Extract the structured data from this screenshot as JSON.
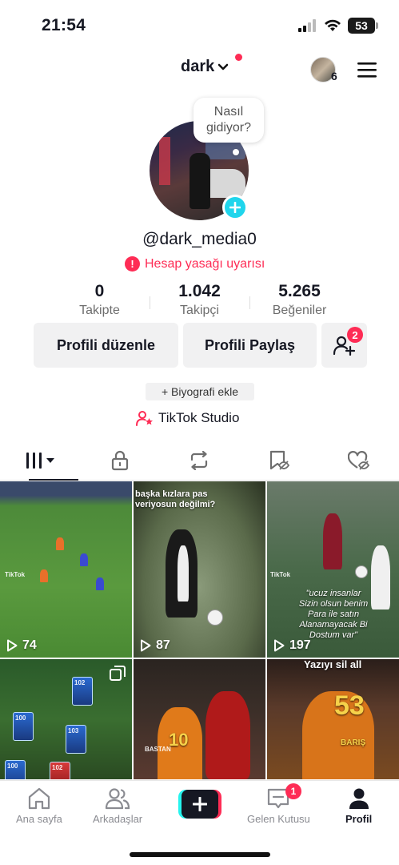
{
  "status_bar": {
    "time": "21:54",
    "battery": "53"
  },
  "header": {
    "account_name": "dark",
    "story_count": "6"
  },
  "profile": {
    "note": "Nasıl gidiyor?",
    "username": "@dark_media0",
    "ban_warning": "Hesap yasağı uyarısı",
    "stats": [
      {
        "value": "0",
        "label": "Takipte"
      },
      {
        "value": "1.042",
        "label": "Takipçi"
      },
      {
        "value": "5.265",
        "label": "Beğeniler"
      }
    ],
    "edit_button": "Profili düzenle",
    "share_button": "Profili Paylaş",
    "add_friends_badge": "2",
    "bio_button": "+ Biyografi ekle",
    "studio_link": "TikTok Studio"
  },
  "tabs": [
    "videos-grid",
    "private",
    "reposts",
    "favorites",
    "liked"
  ],
  "videos": [
    {
      "views": "74",
      "caption": "",
      "watermark": "TikTok"
    },
    {
      "views": "87",
      "caption": "başka kızlara pas\nveriyosun değilmi?",
      "watermark": ""
    },
    {
      "views": "197",
      "caption": "\"ucuz insanlar\nSizin olsun benim\nPara ile satın\nAlanamayacak Bi\nDostum var\"",
      "watermark": "TikTok"
    },
    {
      "views": "",
      "caption": "",
      "watermark": ""
    },
    {
      "views": "",
      "caption": "",
      "watermark": ""
    },
    {
      "views": "",
      "caption": "Yazıyı sil all",
      "watermark": ""
    }
  ],
  "tile_labels": {
    "jersey_a": "10",
    "name_a": "BASTAN",
    "jersey_b": "53",
    "name_b": "BARIŞ",
    "card_values": [
      "102",
      "100",
      "103",
      "100",
      "102"
    ]
  },
  "nav": {
    "home": "Ana sayfa",
    "friends": "Arkadaşlar",
    "inbox": "Gelen Kutusu",
    "inbox_badge": "1",
    "profile": "Profil"
  },
  "colors": {
    "accent_red": "#fe2c55",
    "accent_cyan": "#20d5ec",
    "button_bg": "#f1f1f2"
  }
}
